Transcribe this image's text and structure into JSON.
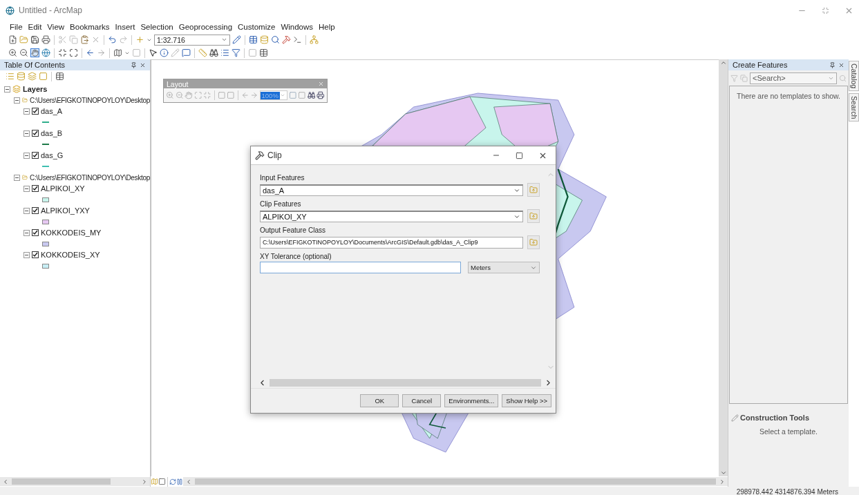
{
  "window": {
    "title": "Untitled - ArcMap"
  },
  "menu": [
    "File",
    "Edit",
    "View",
    "Bookmarks",
    "Insert",
    "Selection",
    "Geoprocessing",
    "Customize",
    "Windows",
    "Help"
  ],
  "toolbar": {
    "scale": "1:32.716"
  },
  "toc": {
    "title": "Table Of Contents",
    "root": {
      "label": "Layers",
      "expanded": true,
      "children": [
        {
          "label": "C:\\Users\\EFIGKOTINOPOYLOY\\Desktop",
          "expanded": true,
          "children": [
            {
              "label": "das_A",
              "expanded": true,
              "checked": true,
              "kind": "line",
              "color": "#2fae8c"
            },
            {
              "label": "das_B",
              "expanded": true,
              "checked": true,
              "kind": "line",
              "color": "#1f7a4a"
            },
            {
              "label": "das_G",
              "expanded": true,
              "checked": true,
              "kind": "line",
              "color": "#3fbfb0"
            }
          ]
        },
        {
          "label": "C:\\Users\\EFIGKOTINOPOYLOY\\Desktop",
          "expanded": true,
          "children": [
            {
              "label": "ALPIKOI_XY",
              "expanded": true,
              "checked": true,
              "kind": "fill",
              "color": "#c8f5ec"
            },
            {
              "label": "ALPIKOI_YXY",
              "expanded": true,
              "checked": true,
              "kind": "fill",
              "color": "#e6c8f2"
            },
            {
              "label": "KOKKODEIS_MY",
              "expanded": true,
              "checked": true,
              "kind": "fill",
              "color": "#c8c8f0"
            },
            {
              "label": "KOKKODEIS_XY",
              "expanded": true,
              "checked": true,
              "kind": "fill",
              "color": "#c8eef5"
            }
          ]
        }
      ]
    }
  },
  "layout_toolbar": {
    "title": "Layout",
    "zoom": "100%"
  },
  "dialog": {
    "title": "Clip",
    "fields": [
      {
        "label": "Input Features",
        "value": "das_A",
        "kind": "combo"
      },
      {
        "label": "Clip Features",
        "value": "ALPIKOI_XY",
        "kind": "combo"
      },
      {
        "label": "Output Feature Class",
        "value": "C:\\Users\\EFIGKOTINOPOYLOY\\Documents\\ArcGIS\\Default.gdb\\das_A_Clip9",
        "kind": "path"
      },
      {
        "label": "XY Tolerance (optional)",
        "kind": "tolerance",
        "unit": "Meters"
      }
    ],
    "buttons": [
      "OK",
      "Cancel",
      "Environments...",
      "Show Help >>"
    ]
  },
  "create_features": {
    "title": "Create Features",
    "search_placeholder": "<Search>",
    "empty_message": "There are no templates to show."
  },
  "construction_tools": {
    "title": "Construction Tools",
    "hint": "Select a template."
  },
  "side_tabs": [
    "Catalog",
    "Search"
  ],
  "status_bar": {
    "coordinates": "298978.442  4314876.394 Meters"
  }
}
